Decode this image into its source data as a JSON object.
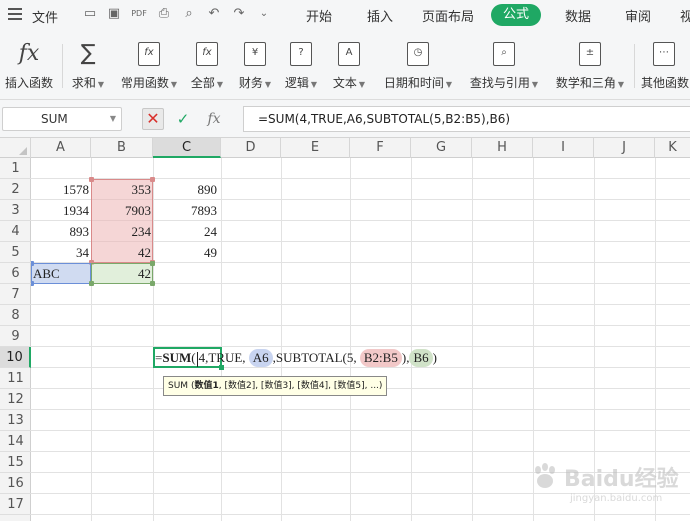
{
  "menubar": {
    "file_label": "文件",
    "tabs": [
      "开始",
      "插入",
      "页面布局",
      "公式",
      "数据",
      "审阅",
      "视"
    ],
    "active_tab": "公式",
    "accent": "#1fa864"
  },
  "ribbon": {
    "buttons": [
      {
        "label": "插入函数",
        "icon": "fx-icon",
        "glyph": "fx"
      },
      {
        "label": "求和",
        "icon": "sigma-icon",
        "glyph": "∑"
      },
      {
        "label": "常用函数",
        "icon": "star-function-icon",
        "glyph": "fx"
      },
      {
        "label": "全部",
        "icon": "all-function-icon",
        "glyph": "fx"
      },
      {
        "label": "财务",
        "icon": "finance-icon",
        "glyph": "¥"
      },
      {
        "label": "逻辑",
        "icon": "logic-icon",
        "glyph": "?"
      },
      {
        "label": "文本",
        "icon": "text-icon",
        "glyph": "A"
      },
      {
        "label": "日期和时间",
        "icon": "clock-icon",
        "glyph": "◷"
      },
      {
        "label": "查找与引用",
        "icon": "lookup-icon",
        "glyph": "⌕"
      },
      {
        "label": "数学和三角",
        "icon": "math-icon",
        "glyph": "±"
      },
      {
        "label": "其他函数",
        "icon": "more-function-icon",
        "glyph": "⋯"
      }
    ]
  },
  "formula_bar": {
    "name_box": "SUM",
    "fx_label": "fx",
    "formula": "=SUM(4,TRUE,A6,SUBTOTAL(5,B2:B5),B6)"
  },
  "columns": [
    "A",
    "B",
    "C",
    "D",
    "E",
    "F",
    "G",
    "H",
    "I",
    "J",
    "K"
  ],
  "selected_column": "C",
  "rows": [
    "1",
    "2",
    "3",
    "4",
    "5",
    "6",
    "7",
    "8",
    "9",
    "10",
    "11",
    "12",
    "13",
    "14",
    "15",
    "16",
    "17"
  ],
  "selected_row": "10",
  "cells": {
    "A2": "1578",
    "B2": "353",
    "C2": "890",
    "A3": "1934",
    "B3": "7903",
    "C3": "7893",
    "A4": "893",
    "B4": "234",
    "C4": "24",
    "A5": "34",
    "B5": "42",
    "C5": "49",
    "A6": "ABC",
    "B6": "42"
  },
  "edit_cell": {
    "prefix": "=",
    "fn": "SUM",
    "open": "(",
    "arg1": "4,TRUE, ",
    "ref_a6": "A6",
    "mid": ",SUBTOTAL(5, ",
    "ref_b2b5": "B2:B5",
    "sep": ")",
    "comma": ",",
    "ref_b6": "B6",
    "close": ")"
  },
  "tooltip": {
    "fn": "SUM",
    "open": "(",
    "arg1": "数值1",
    "rest": ", [数值2], [数值3], [数值4], [数值5], ...)"
  },
  "watermark": {
    "line1": "Baidu经验",
    "line2": "jingyan.baidu.com"
  }
}
